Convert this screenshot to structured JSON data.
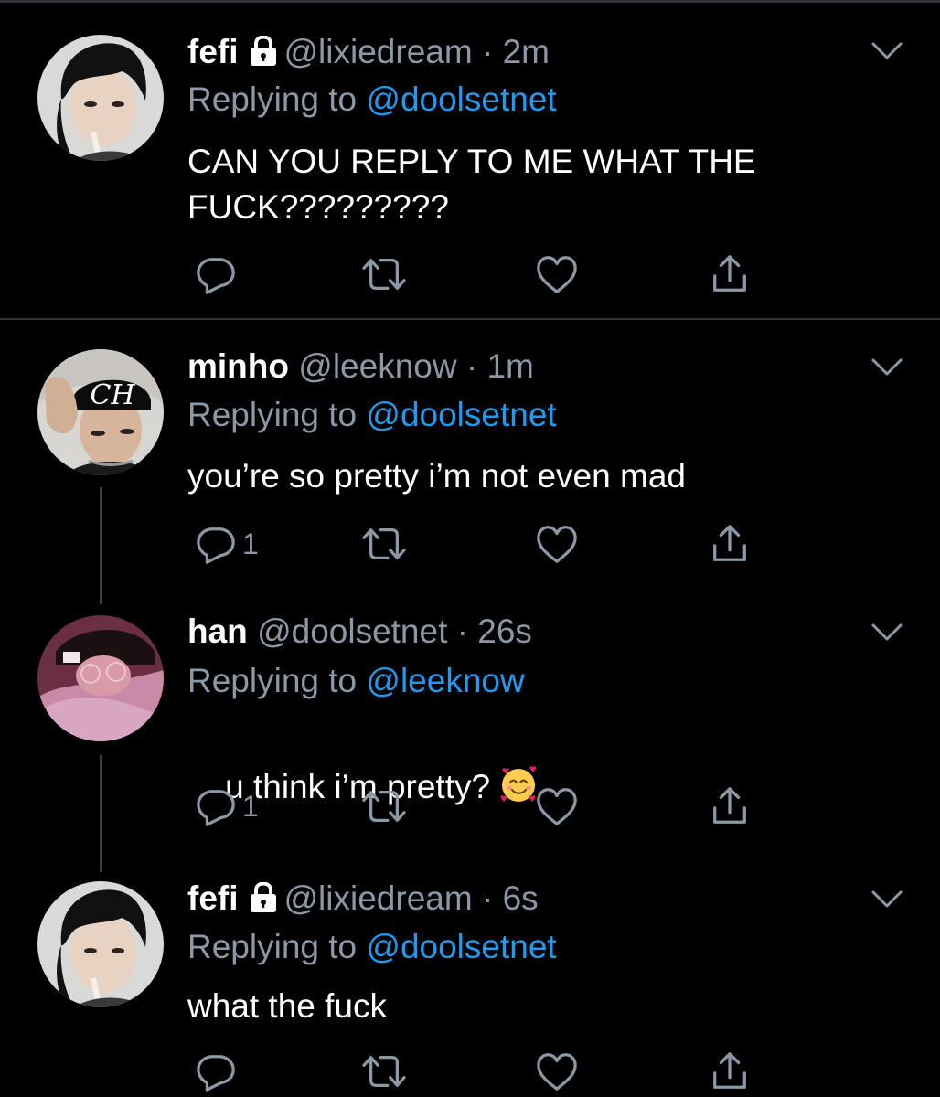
{
  "tweets": [
    {
      "name": "fefi",
      "handle": "@lixiedream",
      "time": "· 2m",
      "replying_prefix": "Replying to ",
      "replying_to": "@doolsetnet",
      "text": "CAN YOU REPLY TO ME WHAT THE FUCK?????????",
      "reply_count": "",
      "protected": true
    },
    {
      "name": "minho",
      "handle": "@leeknow",
      "time": "· 1m",
      "replying_prefix": "Replying to ",
      "replying_to": "@doolsetnet",
      "text": "you’re so pretty i’m not even mad",
      "reply_count": "1",
      "protected": false
    },
    {
      "name": "han",
      "handle": "@doolsetnet",
      "time": "· 26s",
      "replying_prefix": "Replying to ",
      "replying_to": "@leeknow",
      "text": "u think i’m pretty?",
      "reply_count": "1",
      "protected": false
    },
    {
      "name": "fefi",
      "handle": "@lixiedream",
      "time": "· 6s",
      "replying_prefix": "Replying to ",
      "replying_to": "@doolsetnet",
      "text": "what the fuck",
      "reply_count": "",
      "protected": true
    }
  ],
  "avatar_badge_text": "CH",
  "colors": {
    "background": "#000000",
    "secondary_text": "#8b98a5",
    "mention": "#1d9bf0",
    "icon": "#8b98a5",
    "divider": "#2f3336"
  },
  "icons": [
    "lock-icon",
    "chevron-down-icon",
    "reply-icon",
    "retweet-icon",
    "like-icon",
    "share-icon",
    "smiling-face-with-hearts-emoji"
  ]
}
